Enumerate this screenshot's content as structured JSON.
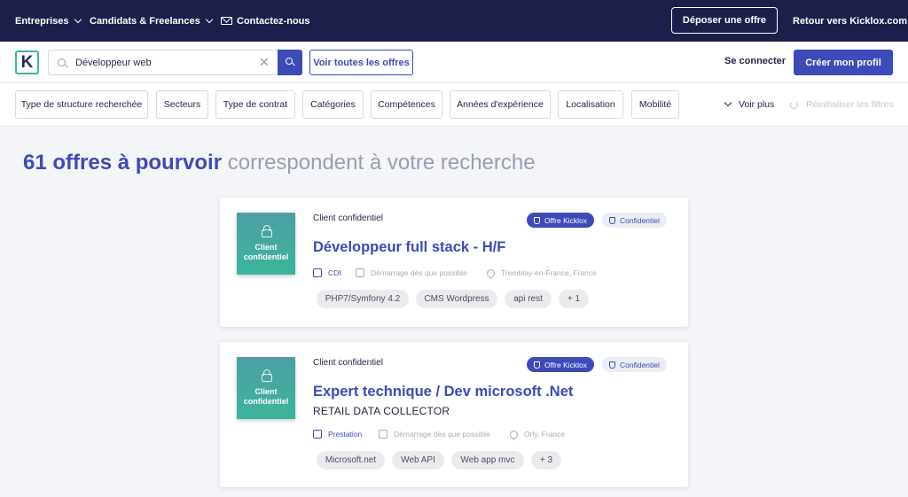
{
  "topnav": {
    "entreprises": "Entreprises",
    "candidats": "Candidats & Freelances",
    "contact": "Contactez-nous",
    "deposer": "Déposer une offre",
    "retour": "Retour vers Kicklox.com"
  },
  "search": {
    "logo_letter": "K",
    "query": "Développeur web",
    "clear_symbol": "✕",
    "voir_toutes": "Voir toutes les offres",
    "connect": "Se connecter",
    "creer": "Créer mon profil"
  },
  "filters": {
    "items": [
      "Type de structure recherchée",
      "Secteurs",
      "Type de contrat",
      "Catégories",
      "Compétences",
      "Années d'expérience",
      "Localisation",
      "Mobilité"
    ],
    "voir_plus": "Voir plus",
    "reset": "Réinitialiser les filtres"
  },
  "heading": {
    "count": "61 offres à pourvoir",
    "rest": " correspondent à votre recherche"
  },
  "cards": [
    {
      "thumb_label": "Client confidentiel",
      "client": "Client confidentiel",
      "badge_kicklox": "Offre Kicklox",
      "badge_confidentiel": "Confidentiel",
      "title": "Développeur full stack - H/F",
      "subtitle": "",
      "contract": "CDI",
      "start": "Démarrage dès que possible",
      "location": "Tremblay-en-France, France",
      "tags": [
        "PHP7/Symfony 4.2",
        "CMS Wordpress",
        "api rest",
        "+ 1"
      ]
    },
    {
      "thumb_label": "Client confidentiel",
      "client": "Client confidentiel",
      "badge_kicklox": "Offre Kicklox",
      "badge_confidentiel": "Confidentiel",
      "title": "Expert technique / Dev microsoft .Net",
      "subtitle": "RETAIL DATA COLLECTOR",
      "contract": "Prestation",
      "start": "Démarrage dès que possible",
      "location": "Orly, France",
      "tags": [
        "Microsoft.net",
        "Web API",
        "Web app mvc",
        "+ 3"
      ]
    }
  ],
  "colors": {
    "nav_bg": "#1c1f4a",
    "accent": "#3d4ab8",
    "teal": "#3cb49b",
    "page_bg": "#f4f5f9"
  }
}
